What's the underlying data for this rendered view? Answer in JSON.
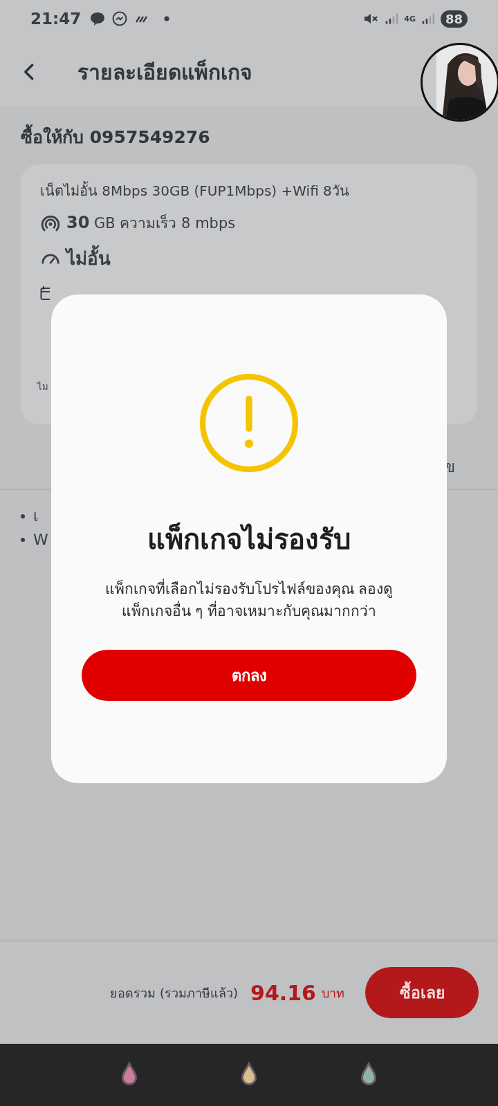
{
  "status_bar": {
    "time": "21:47",
    "network": "4G",
    "battery": "88"
  },
  "header": {
    "title": "รายละเอียดแพ็กเกจ"
  },
  "recipient": "ซื้อให้กับ 0957549276",
  "package": {
    "name": "เน็ตไม่อั้น 8Mbps 30GB (FUP1Mbps) +Wifi 8วัน",
    "data": "**30** GB ความเร็ว 8 mbps",
    "speed": "ไม่อั้น",
    "note": "ไม"
  },
  "side_text": "ข",
  "details": [
    "เ",
    "W"
  ],
  "dialog": {
    "title": "แพ็กเกจไม่รองรับ",
    "message": "แพ็กเกจที่เลือกไม่รองรับโปรไฟล์ของคุณ ลองดูแพ็กเกจอื่น ๆ ที่อาจเหมาะกับคุณมากกว่า",
    "button": "ตกลง"
  },
  "footer": {
    "total_label": "ยอดรวม (รวมภาษีแล้ว)",
    "total": "94.16",
    "currency": "บาท",
    "buy_button": "ซื้อเลย"
  }
}
